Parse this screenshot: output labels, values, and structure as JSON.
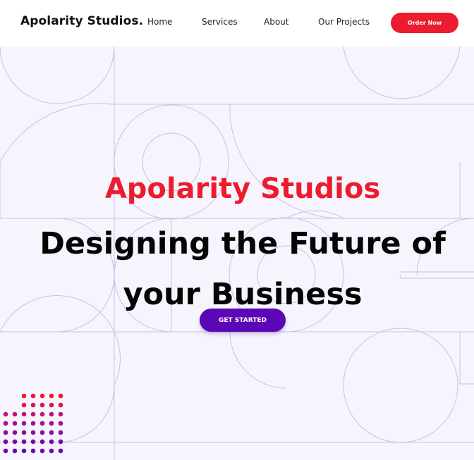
{
  "header": {
    "logo": "Apolarity Studios.",
    "nav": {
      "home": "Home",
      "services": "Services",
      "about": "About",
      "projects": "Our Projects"
    },
    "order_button": "Order Now"
  },
  "hero": {
    "brand": "Apolarity Studios",
    "headline": "Designing the Future of your Business",
    "cta": "GET STARTED"
  },
  "colors": {
    "brand_red": "#ec1c2e",
    "cta_purple": "#5c07b5",
    "background": "#f6f5fd",
    "pattern_line": "#c9b6e4",
    "dot_gradient": [
      "#ec1c2e",
      "#9b0f8f",
      "#6a0dad"
    ]
  },
  "decor": {
    "background": "line-art-circle-pattern",
    "corner": "dot-grid"
  }
}
